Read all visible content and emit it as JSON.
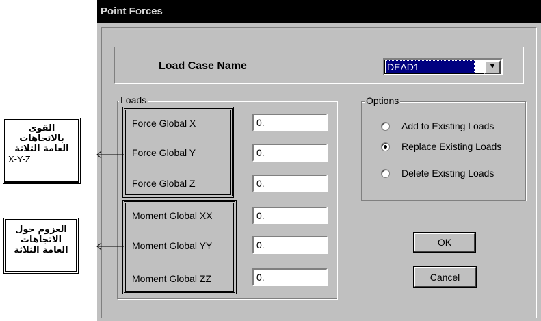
{
  "window": {
    "title": "Point Forces"
  },
  "load_case": {
    "label": "Load Case Name",
    "selected": "DEAD1",
    "dropdown_icon": "triangle-down"
  },
  "loads": {
    "group_title": "Loads",
    "fields": [
      {
        "label": "Force Global X",
        "value": "0."
      },
      {
        "label": "Force Global Y",
        "value": "0."
      },
      {
        "label": "Force Global Z",
        "value": "0."
      },
      {
        "label": "Moment Global XX",
        "value": "0."
      },
      {
        "label": "Moment Global YY",
        "value": "0."
      },
      {
        "label": "Moment Global ZZ",
        "value": "0."
      }
    ]
  },
  "options": {
    "group_title": "Options",
    "items": [
      {
        "label": "Add to Existing Loads",
        "checked": false
      },
      {
        "label": "Replace Existing Loads",
        "checked": true
      },
      {
        "label": "Delete Existing Loads",
        "checked": false
      }
    ]
  },
  "buttons": {
    "ok": "OK",
    "cancel": "Cancel"
  },
  "annotations": {
    "forces": {
      "line1": "القوى",
      "line2": "بالاتجاهات",
      "line3": "العامة الثلاثة",
      "line4": "X-Y-Z"
    },
    "moments": {
      "line1": "العزوم حول",
      "line2": "الاتجاهات",
      "line3": "العامة الثلاثة"
    }
  }
}
